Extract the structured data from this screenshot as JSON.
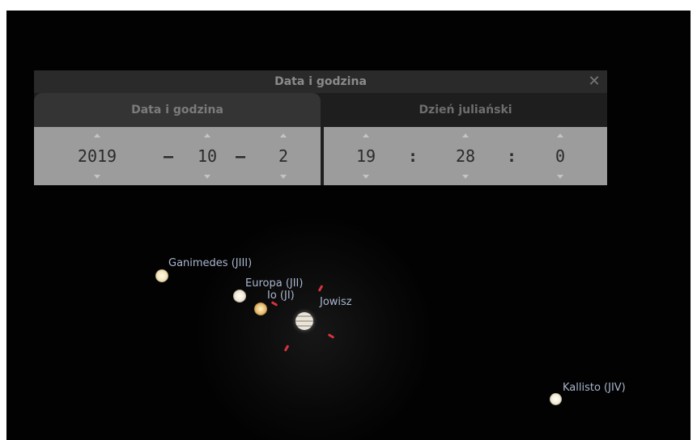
{
  "dialog": {
    "title": "Data i godzina",
    "close_symbol": "✕",
    "tabs": [
      {
        "label": "Data i godzina",
        "active": true
      },
      {
        "label": "Dzień juliański",
        "active": false
      }
    ],
    "date": {
      "year": "2019",
      "month": "10",
      "day": "2",
      "separator": "–"
    },
    "time": {
      "hour": "19",
      "minute": "28",
      "second": "0",
      "separator": ":"
    }
  },
  "sky": {
    "planet": {
      "label": "Jowisz"
    },
    "moons": [
      {
        "label": "Ganimedes (JIII)"
      },
      {
        "label": "Europa (JII)"
      },
      {
        "label": "Io (JI)"
      },
      {
        "label": "Kallisto (JIV)"
      }
    ]
  },
  "colors": {
    "label": "#a9b6cf",
    "marker": "#d8343c",
    "spin_bg": "#9c9c9c"
  }
}
